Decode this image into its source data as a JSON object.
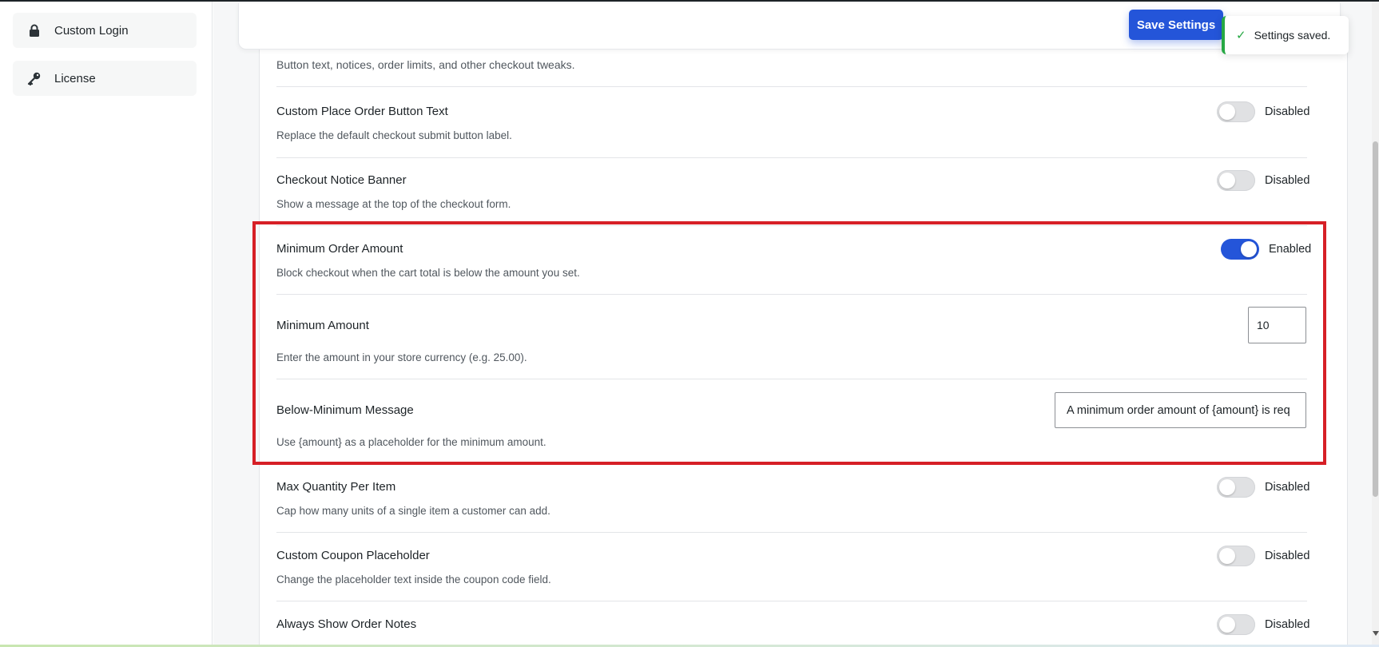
{
  "sidebar": {
    "items": [
      {
        "label": "Custom Login",
        "icon": "lock-icon"
      },
      {
        "label": "License",
        "icon": "key-icon"
      }
    ]
  },
  "toolbar": {
    "save_label": "Save Settings"
  },
  "toast": {
    "message": "Settings saved.",
    "icon": "check-icon",
    "color": "#27a844"
  },
  "section": {
    "description": "Button text, notices, order limits, and other checkout tweaks."
  },
  "settings": [
    {
      "title": "Custom Place Order Button Text",
      "description": "Replace the default checkout submit button label.",
      "state": "Disabled",
      "enabled": false
    },
    {
      "title": "Checkout Notice Banner",
      "description": "Show a message at the top of the checkout form.",
      "state": "Disabled",
      "enabled": false
    },
    {
      "title": "Minimum Order Amount",
      "description": "Block checkout when the cart total is below the amount you set.",
      "state": "Enabled",
      "enabled": true
    },
    {
      "title": "Max Quantity Per Item",
      "description": "Cap how many units of a single item a customer can add.",
      "state": "Disabled",
      "enabled": false
    },
    {
      "title": "Custom Coupon Placeholder",
      "description": "Change the placeholder text inside the coupon code field.",
      "state": "Disabled",
      "enabled": false
    },
    {
      "title": "Always Show Order Notes",
      "description": "",
      "state": "Disabled",
      "enabled": false
    }
  ],
  "min_amount": {
    "label": "Minimum Amount",
    "value": "10",
    "description": "Enter the amount in your store currency (e.g. 25.00)."
  },
  "below_min_message": {
    "label": "Below-Minimum Message",
    "value": "A minimum order amount of {amount} is req",
    "description": "Use {amount} as a placeholder for the minimum amount."
  },
  "colors": {
    "accent": "#2455d9",
    "highlight": "#d61f26",
    "success": "#27a844"
  }
}
